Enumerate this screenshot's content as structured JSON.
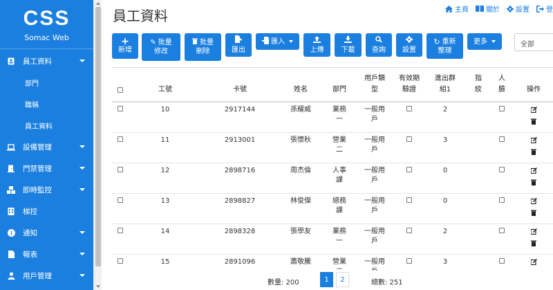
{
  "sidebar": {
    "logo_mark": "CSS",
    "logo_name": "Somac Web",
    "items": [
      {
        "label": "員工資料"
      },
      {
        "label": "設備管理"
      },
      {
        "label": "門禁管理"
      },
      {
        "label": "即時監控"
      },
      {
        "label": "梯控"
      },
      {
        "label": "通知"
      },
      {
        "label": "報表"
      },
      {
        "label": "用戶管理"
      }
    ],
    "subitems": [
      {
        "label": "部門"
      },
      {
        "label": "職稱"
      },
      {
        "label": "員工資料"
      }
    ]
  },
  "header": {
    "title": "員工資料",
    "links": {
      "home": "主頁",
      "about": "關於",
      "settings": "設置",
      "logout": "登"
    }
  },
  "toolbar": {
    "add": "新增",
    "batch_edit_1": "批量",
    "batch_edit_2": "修改",
    "batch_delete_1": "批量",
    "batch_delete_2": "刪除",
    "export": "匯出",
    "import": "匯入",
    "upload": "上傳",
    "download": "下載",
    "query": "查詢",
    "settings": "設置",
    "reorg_1": "重新",
    "reorg_2": "整理",
    "more": "更多",
    "dept_select": "全部"
  },
  "table": {
    "headers": {
      "id": "工號",
      "card": "卡號",
      "name": "姓名",
      "dept": "部門",
      "usertype_1": "用戶類",
      "usertype_2": "型",
      "valid_1": "有效期",
      "valid_2": "驗證",
      "group_1": "進出群",
      "group_2": "組1",
      "finger_1": "指",
      "finger_2": "紋",
      "face_1": "人",
      "face_2": "臉",
      "action": "操作"
    },
    "rows": [
      {
        "id": "10",
        "card": "2917144",
        "name": "孫耀威",
        "dept_1": "業務",
        "dept_2": "一",
        "type_1": "一般用",
        "type_2": "戶",
        "group": "2"
      },
      {
        "id": "11",
        "card": "2913001",
        "name": "張懷秋",
        "dept_1": "營業",
        "dept_2": "二",
        "type_1": "一般用",
        "type_2": "戶",
        "group": "3"
      },
      {
        "id": "12",
        "card": "2898716",
        "name": "周杰倫",
        "dept_1": "人事",
        "dept_2": "課",
        "type_1": "一般用",
        "type_2": "戶",
        "group": "0"
      },
      {
        "id": "13",
        "card": "2898827",
        "name": "林俊傑",
        "dept_1": "總務",
        "dept_2": "課",
        "type_1": "一般用",
        "type_2": "戶",
        "group": "0"
      },
      {
        "id": "14",
        "card": "2898328",
        "name": "張學友",
        "dept_1": "業務",
        "dept_2": "一",
        "type_1": "一般用",
        "type_2": "戶",
        "group": "2"
      },
      {
        "id": "15",
        "card": "2891096",
        "name": "蕭敬騰",
        "dept_1": "營業",
        "dept_2": "二",
        "type_1": "一般用",
        "type_2": "戶",
        "group": "3"
      }
    ]
  },
  "pager": {
    "count_label": "數量: 200",
    "page1": "1",
    "page2": "2",
    "total_label": "總數: 251"
  },
  "colors": {
    "accent": "#1b7fe0",
    "sidebar": "#1b7fe0"
  }
}
